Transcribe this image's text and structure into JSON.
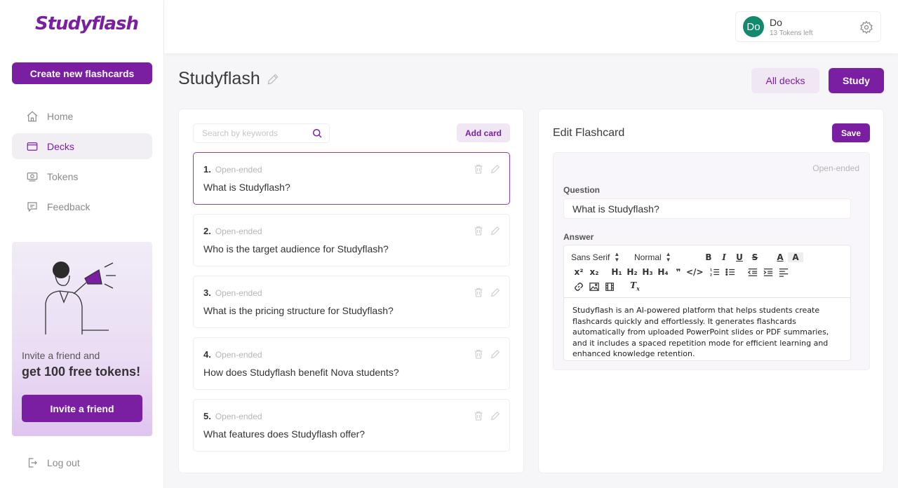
{
  "brand": {
    "logo_text": "Studyflash",
    "accent": "#7a1fa2"
  },
  "sidebar": {
    "create_label": "Create new flashcards",
    "items": [
      {
        "label": "Home",
        "icon": "home-icon",
        "active": false
      },
      {
        "label": "Decks",
        "icon": "deck-icon",
        "active": true
      },
      {
        "label": "Tokens",
        "icon": "tokens-icon",
        "active": false
      },
      {
        "label": "Feedback",
        "icon": "feedback-icon",
        "active": false
      }
    ],
    "promo": {
      "line1": "Invite a friend and",
      "line2": "get 100 free tokens!",
      "button": "Invite a friend"
    },
    "logout_label": "Log out"
  },
  "user": {
    "initials": "Do",
    "name": "Do",
    "tokens": "13 Tokens left"
  },
  "deck": {
    "title": "Studyflash"
  },
  "header": {
    "all_decks_label": "All decks",
    "study_label": "Study"
  },
  "list": {
    "search_placeholder": "Search by keywords",
    "add_card_label": "Add card",
    "cards": [
      {
        "num": "1.",
        "type": "Open-ended",
        "question": "What is Studyflash?"
      },
      {
        "num": "2.",
        "type": "Open-ended",
        "question": "Who is the target audience for Studyflash?"
      },
      {
        "num": "3.",
        "type": "Open-ended",
        "question": "What is the pricing structure for Studyflash?"
      },
      {
        "num": "4.",
        "type": "Open-ended",
        "question": "How does Studyflash benefit Nova students?"
      },
      {
        "num": "5.",
        "type": "Open-ended",
        "question": "What features does Studyflash offer?"
      }
    ]
  },
  "editor": {
    "title": "Edit Flashcard",
    "save_label": "Save",
    "type": "Open-ended",
    "question_label": "Question",
    "question_value": "What is Studyflash?",
    "answer_label": "Answer",
    "font_select": "Sans Serif",
    "size_select": "Normal",
    "answer_text": "Studyflash is an AI-powered platform that helps students create flashcards quickly and effortlessly. It generates flashcards automatically from uploaded PowerPoint slides or PDF summaries, and it includes a spaced repetition mode for efficient learning and enhanced knowledge retention."
  }
}
